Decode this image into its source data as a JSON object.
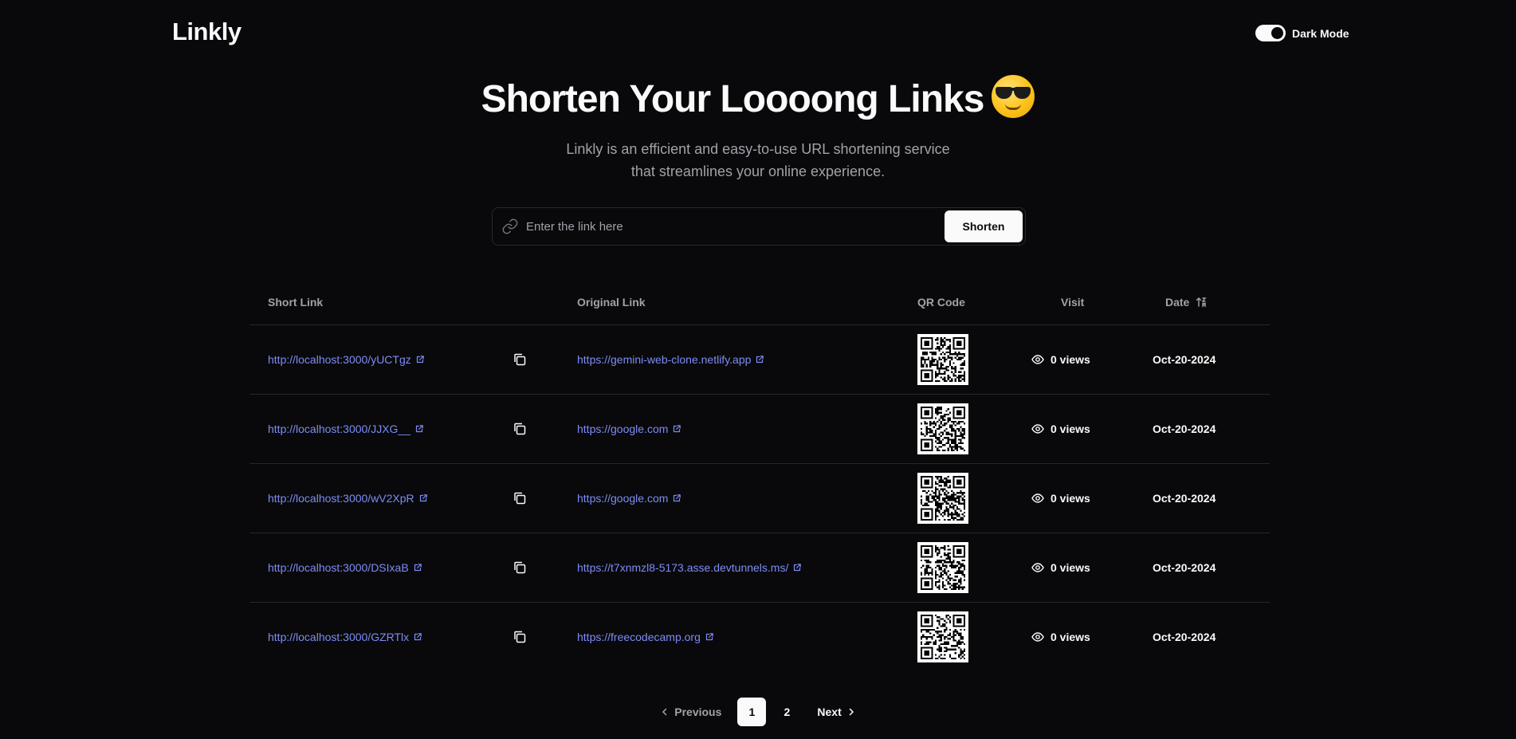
{
  "header": {
    "logo": "Linkly",
    "mode_label": "Dark Mode"
  },
  "hero": {
    "title": "Shorten Your Loooong Links",
    "emoji_icon": "smiling-face-with-sunglasses-icon",
    "subtitle_line1": "Linkly is an efficient and easy-to-use URL shortening service",
    "subtitle_line2": "that streamlines your online experience."
  },
  "form": {
    "placeholder": "Enter the link here",
    "value": "",
    "button_label": "Shorten"
  },
  "table": {
    "headers": {
      "short_link": "Short Link",
      "original_link": "Original Link",
      "qr_code": "QR Code",
      "visit": "Visit",
      "date": "Date"
    },
    "rows": [
      {
        "short": "http://localhost:3000/yUCTgz",
        "original": "https://gemini-web-clone.netlify.app",
        "views": "0 views",
        "date": "Oct-20-2024"
      },
      {
        "short": "http://localhost:3000/JJXG__",
        "original": "https://google.com",
        "views": "0 views",
        "date": "Oct-20-2024"
      },
      {
        "short": "http://localhost:3000/wV2XpR",
        "original": "https://google.com",
        "views": "0 views",
        "date": "Oct-20-2024"
      },
      {
        "short": "http://localhost:3000/DSIxaB",
        "original": "https://t7xnmzl8-5173.asse.devtunnels.ms/",
        "views": "0 views",
        "date": "Oct-20-2024"
      },
      {
        "short": "http://localhost:3000/GZRTlx",
        "original": "https://freecodecamp.org",
        "views": "0 views",
        "date": "Oct-20-2024"
      }
    ]
  },
  "pagination": {
    "previous": "Previous",
    "pages": [
      "1",
      "2"
    ],
    "current": "1",
    "next": "Next"
  },
  "colors": {
    "background": "#09090b",
    "link": "#7c8cf5",
    "border": "#27272a",
    "muted": "#a1a1aa"
  }
}
